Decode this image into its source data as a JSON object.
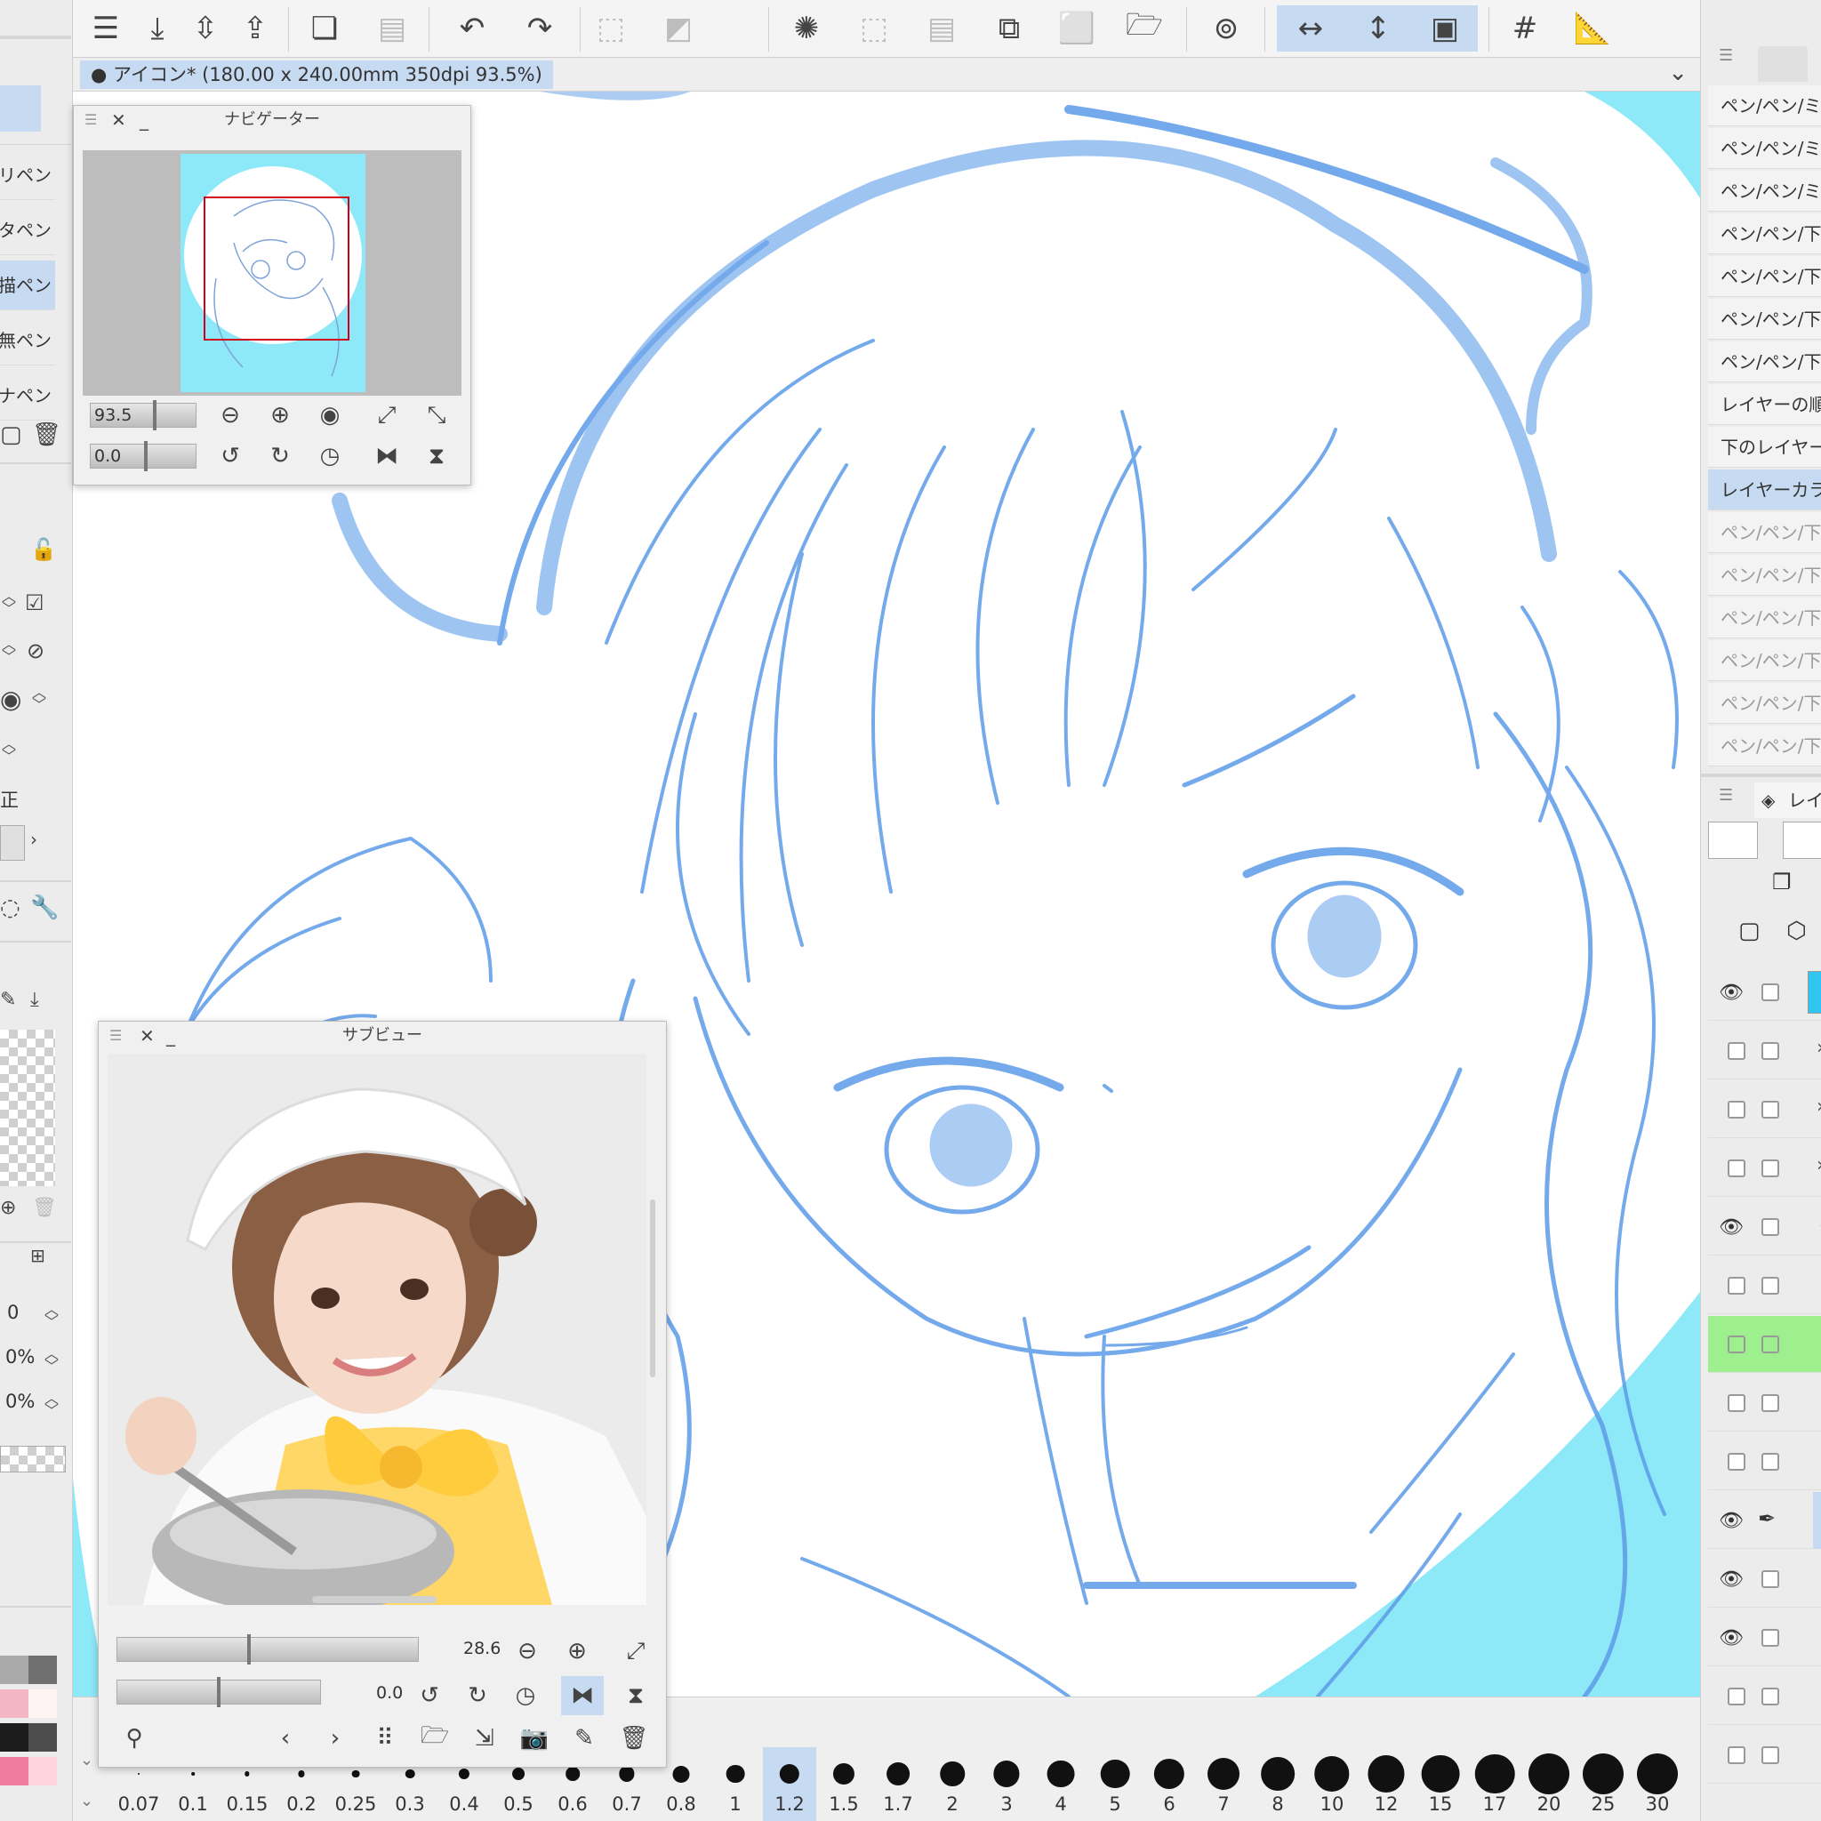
{
  "document": {
    "tab_title": "● アイコン* (180.00 x 240.00mm 350dpi 93.5%)"
  },
  "toolbar": {
    "icons": [
      "menu-icon",
      "save-icon",
      "sort-icon",
      "export-icon",
      "copy-icon",
      "paste-icon",
      "undo-icon",
      "redo-icon",
      "clear-icon",
      "clear-outside-icon",
      "marching-ants-icon",
      "select-all-icon",
      "deselect-icon",
      "duplicate-icon",
      "transform-icon",
      "open-folder-icon",
      "lasso-icon",
      "flip-horizontal-icon",
      "flip-vertical-icon",
      "fullscreen-icon",
      "grid-icon",
      "ruler-icon"
    ]
  },
  "left_panel": {
    "brushes": [
      {
        "label": "リペン"
      },
      {
        "label": "タペン"
      },
      {
        "label": "描ペン",
        "selected": true
      },
      {
        "label": "無ペン"
      },
      {
        "label": "ナペン"
      }
    ],
    "correction_label": "正",
    "values": [
      "0",
      "0%",
      "0%"
    ]
  },
  "navigator": {
    "title": "ナビゲーター",
    "zoom": "93.5",
    "rotation": "0.0"
  },
  "subview": {
    "title": "サブビュー",
    "zoom": "28.6",
    "rotation": "0.0"
  },
  "history": {
    "items": [
      {
        "label": "ペン/ペン/ミ"
      },
      {
        "label": "ペン/ペン/ミ"
      },
      {
        "label": "ペン/ペン/ミ"
      },
      {
        "label": "ペン/ペン/下"
      },
      {
        "label": "ペン/ペン/下"
      },
      {
        "label": "ペン/ペン/下"
      },
      {
        "label": "ペン/ペン/下"
      },
      {
        "label": "レイヤーの順"
      },
      {
        "label": "下のレイヤー"
      },
      {
        "label": "レイヤーカラ",
        "selected": true
      },
      {
        "label": "ペン/ペン/下",
        "dim": true
      },
      {
        "label": "ペン/ペン/下",
        "dim": true
      },
      {
        "label": "ペン/ペン/下",
        "dim": true
      },
      {
        "label": "ペン/ペン/下",
        "dim": true
      },
      {
        "label": "ペン/ペン/下",
        "dim": true
      },
      {
        "label": "ペン/ペン/下",
        "dim": true
      }
    ]
  },
  "layers": {
    "panel_title": "レイ"
  },
  "brush_sizes": {
    "labels": [
      "0.07",
      "0.1",
      "0.15",
      "0.2",
      "0.25",
      "0.3",
      "0.4",
      "0.5",
      "0.6",
      "0.7",
      "0.8",
      "1",
      "1.2",
      "1.5",
      "1.7",
      "2",
      "3",
      "4",
      "5",
      "6",
      "7",
      "8",
      "10",
      "12",
      "15",
      "17",
      "20",
      "25",
      "30"
    ],
    "selected": "1.2"
  },
  "colors": {
    "accent": "#c6daf2",
    "sketch_line": "#5b9be8",
    "cyan_bg": "#8de8f7",
    "navigator_frame": "#d2001a",
    "layer_highlight": "#9df08d"
  }
}
